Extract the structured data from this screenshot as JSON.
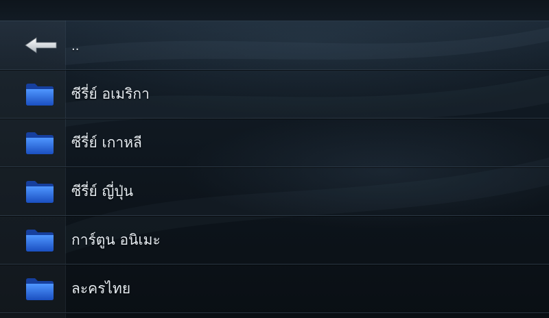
{
  "browser": {
    "parent_item": {
      "label": "..",
      "icon": "back-arrow-icon"
    },
    "items": [
      {
        "label": "ซีรี่ย์ อเมริกา",
        "icon": "folder-icon"
      },
      {
        "label": "ซีรี่ย์ เกาหลี",
        "icon": "folder-icon"
      },
      {
        "label": "ซีรี่ย์ ญี่ปุ่น",
        "icon": "folder-icon"
      },
      {
        "label": "การ์ตูน อนิเมะ",
        "icon": "folder-icon"
      },
      {
        "label": "ละครไทย",
        "icon": "folder-icon"
      }
    ]
  },
  "colors": {
    "folder": "#2a6fe0",
    "text": "#e6ecf1",
    "background": "#0d141b"
  }
}
